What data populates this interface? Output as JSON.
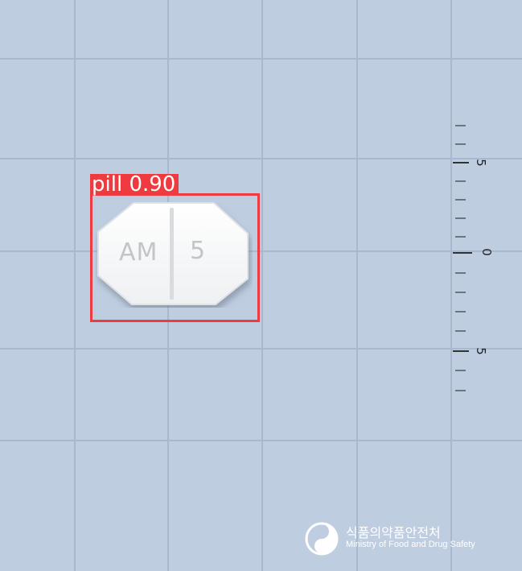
{
  "detection": {
    "label": "pill 0.90",
    "color": "#ef3a3f"
  },
  "pill": {
    "imprint_left": "AM",
    "imprint_right": "5",
    "shape": "octagonal-scored-tablet",
    "color": "#ffffff"
  },
  "ruler": {
    "labels": [
      "5",
      "0",
      "5"
    ]
  },
  "watermark": {
    "korean": "식품의약품안전처",
    "english": "Ministry of Food and Drug Safety",
    "logo": "mfds-logo-icon"
  },
  "colors": {
    "background": "#bfcde0",
    "grid": "#a9b9cd"
  }
}
